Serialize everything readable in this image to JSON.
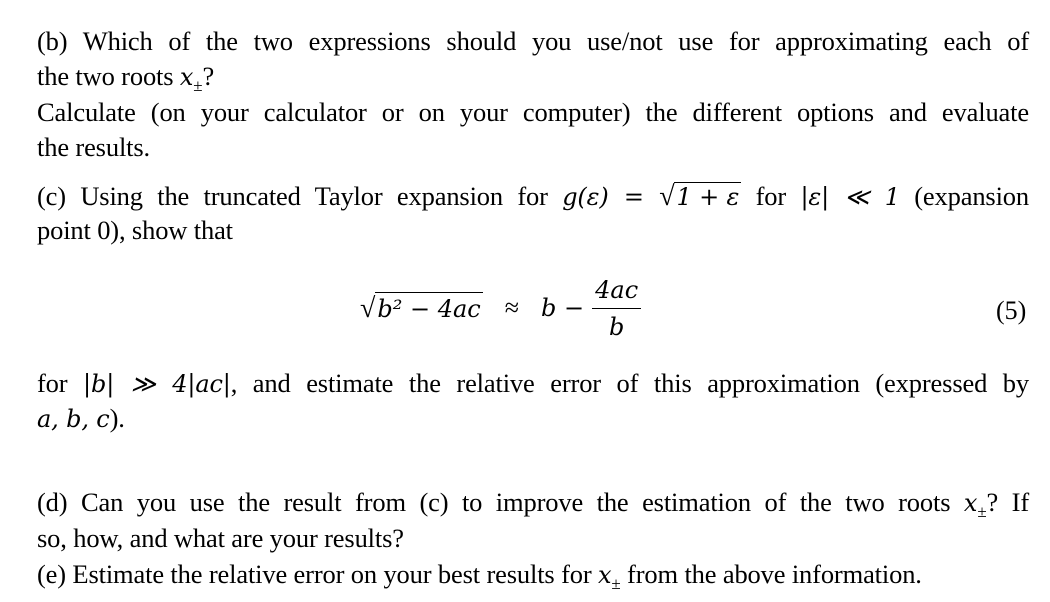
{
  "part_b": {
    "line1": "(b) Which of the two expressions should you use/not use for approximating each of",
    "line2_prefix": "the two roots ",
    "root_var": "x",
    "root_sub": "±",
    "line2_suffix": "?",
    "line3": "Calculate (on your calculator or on your computer) the different options and evaluate",
    "line4": "the results."
  },
  "part_c": {
    "line1_prefix": "(c) Using the truncated Taylor expansion for ",
    "func": "g(ε) = ",
    "sqrt_arg": "1 + ε",
    "line1_mid": " for ",
    "cond": "|ε| ≪ 1",
    "line1_suffix": " (expansion",
    "line2": "point 0), show that",
    "equation": {
      "lhs_sqrt_arg": "b² − 4ac",
      "approx": "≈",
      "rhs_b": "b −",
      "frac_num": "4ac",
      "frac_den": "b",
      "number": "(5)"
    },
    "line3_prefix": "for ",
    "line3_cond": "|b| ≫ 4|ac|",
    "line3_suffix": ", and estimate the relative error of this approximation (expressed by",
    "line4_vars": "a, b, c",
    "line4_suffix": ")."
  },
  "part_d": {
    "line1_prefix": "(d) Can you use the result from (c) to improve the estimation of the two roots ",
    "line1_suffix": "? If",
    "line2": "so, how, and what are your results?"
  },
  "part_e": {
    "line1_prefix": "(e) Estimate the relative error on your best results for ",
    "line1_suffix": " from the above information."
  }
}
